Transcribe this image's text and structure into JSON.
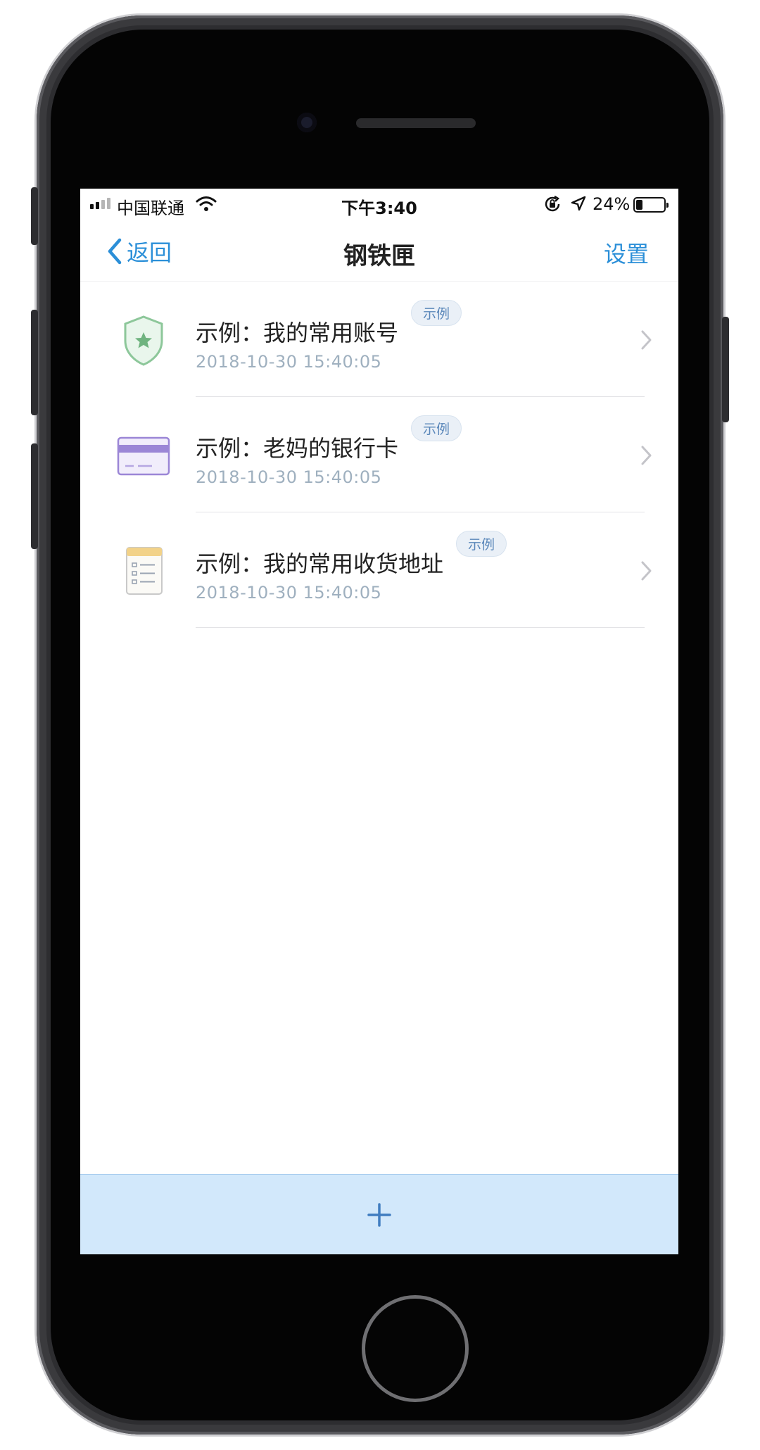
{
  "status_bar": {
    "carrier": "中国联通",
    "time": "下午3:40",
    "battery_percent": "24%",
    "battery_level": 0.24,
    "icons": [
      "signal-icon",
      "wifi-icon",
      "rotation-lock-icon",
      "location-arrow-icon",
      "battery-icon"
    ]
  },
  "nav": {
    "back_label": "返回",
    "title": "钢铁匣",
    "settings_label": "设置"
  },
  "items": [
    {
      "icon": "shield-icon",
      "title": "示例：我的常用账号",
      "tag": "示例",
      "date": "2018-10-30 15:40:05"
    },
    {
      "icon": "bank-card-icon",
      "title": "示例：老妈的银行卡",
      "tag": "示例",
      "date": "2018-10-30 15:40:05"
    },
    {
      "icon": "notepad-icon",
      "title": "示例：我的常用收货地址",
      "tag": "示例",
      "date": "2018-10-30 15:40:05"
    }
  ],
  "add_bar": {
    "icon": "plus-icon"
  },
  "colors": {
    "accent": "#2b8fd8",
    "add_bar_bg": "#d2e8fb",
    "tag_text": "#5a87ba",
    "date_text": "#9fb0bf",
    "shield_green": "#8dc79a",
    "card_purple": "#9b86d6",
    "notepad_yellow": "#f2d289"
  }
}
